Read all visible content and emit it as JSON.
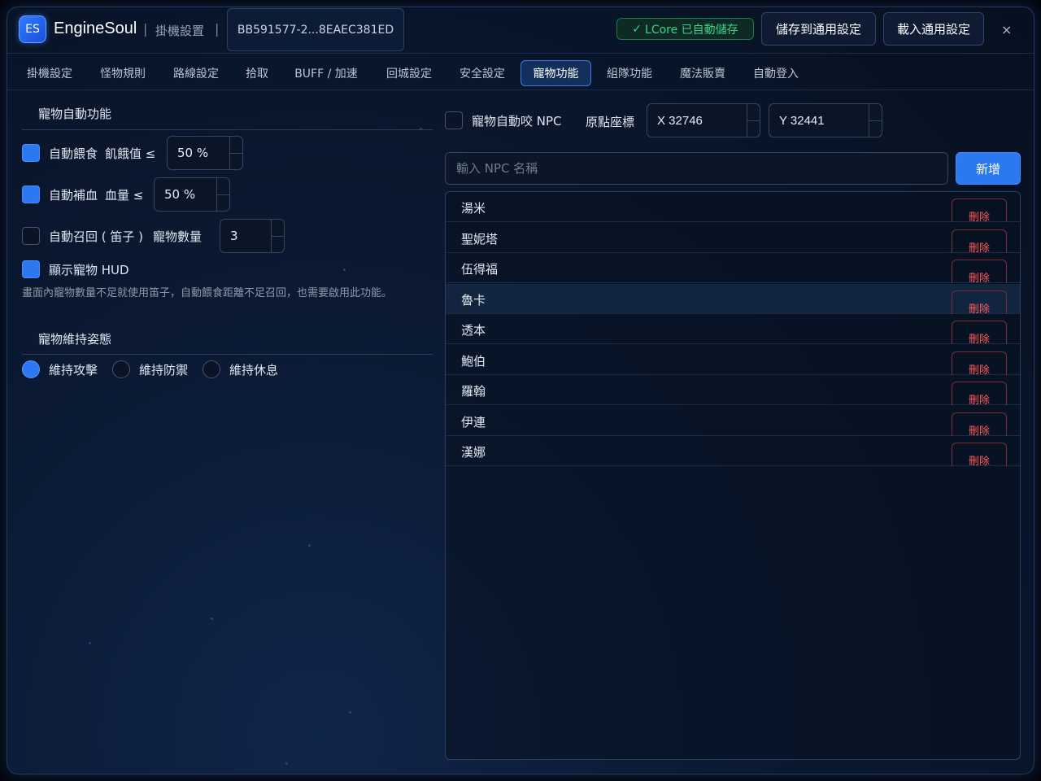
{
  "header": {
    "logo": "ES",
    "brand": "EngineSoul",
    "page_name": "掛機設置",
    "session_id": "BB591577-2...8EAEC381ED",
    "autosave_badge": "LCore 已自動儲存",
    "save_button": "儲存到通用設定",
    "load_button": "載入通用設定",
    "close": "×"
  },
  "tabs": [
    {
      "label": "掛機設定"
    },
    {
      "label": "怪物規則"
    },
    {
      "label": "路線設定"
    },
    {
      "label": "拾取"
    },
    {
      "label": "BUFF / 加速"
    },
    {
      "label": "回城設定"
    },
    {
      "label": "安全設定"
    },
    {
      "label": "寵物功能",
      "active": true
    },
    {
      "label": "組隊功能"
    },
    {
      "label": "魔法販賣"
    },
    {
      "label": "自動登入"
    }
  ],
  "pet_auto": {
    "title": "寵物自動功能",
    "feed": {
      "label": "自動餵食",
      "cond": "飢餓值 ≤",
      "value": "50 %",
      "checked": true
    },
    "heal": {
      "label": "自動補血",
      "cond": "血量 ≤",
      "value": "50 %",
      "checked": true
    },
    "recall": {
      "label": "自動召回 ( 笛子 )",
      "cond": "寵物數量",
      "value": "3",
      "checked": false
    },
    "hud": {
      "label": "顯示寵物 HUD",
      "checked": true
    },
    "hint": "畫面內寵物數量不足就使用笛子，自動餵食距離不足召回，也需要啟用此功能。"
  },
  "stance": {
    "title": "寵物維持姿態",
    "options": [
      {
        "label": "維持攻擊",
        "selected": true
      },
      {
        "label": "維持防禦",
        "selected": false
      },
      {
        "label": "維持休息",
        "selected": false
      }
    ]
  },
  "npc": {
    "auto_bite_label": "寵物自動咬 NPC",
    "auto_bite_checked": false,
    "origin_label": "原點座標",
    "x": "X 32746",
    "y": "Y 32441",
    "input_placeholder": "輸入 NPC 名稱",
    "add_button": "新增",
    "delete_label": "刪除",
    "list": [
      "湯米",
      "聖妮塔",
      "伍得福",
      "魯卡",
      "透本",
      "鮑伯",
      "羅翰",
      "伊連",
      "漢娜"
    ],
    "highlighted": "魯卡"
  },
  "colors": {
    "accent": "#2b78f0",
    "success": "#3fd28a",
    "danger": "#ff5a5a",
    "background": "#0b1a33"
  }
}
